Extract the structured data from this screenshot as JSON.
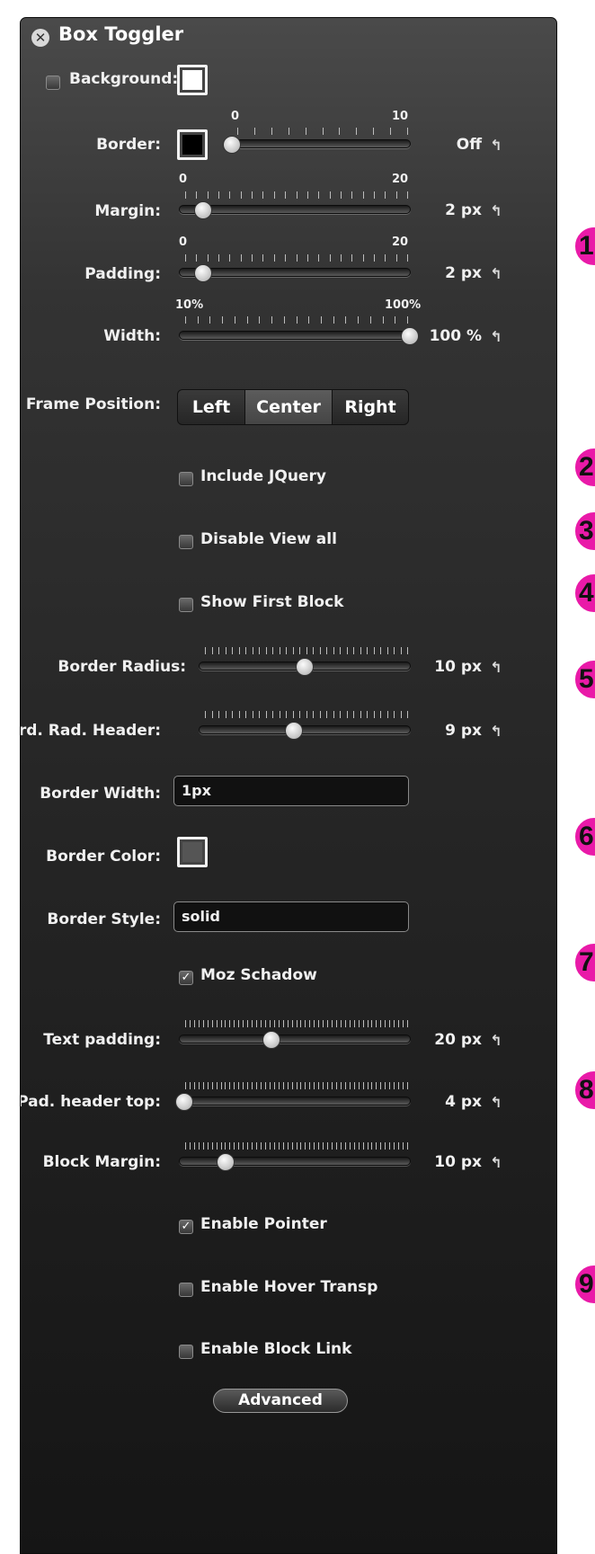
{
  "window": {
    "title": "Box Toggler"
  },
  "background": {
    "label": "Background:",
    "checked": false,
    "swatch_color": "#ffffff"
  },
  "border": {
    "label": "Border:",
    "swatch_color": "#000000",
    "min": "0",
    "max": "10",
    "value": 0,
    "value_text": "Off"
  },
  "margin": {
    "label": "Margin:",
    "min": "0",
    "max": "20",
    "value": 2,
    "value_text": "2 px"
  },
  "padding": {
    "label": "Padding:",
    "min": "0",
    "max": "20",
    "value": 2,
    "value_text": "2 px"
  },
  "width": {
    "label": "Width:",
    "min": "10%",
    "max": "100%",
    "value": 100,
    "value_text": "100 %"
  },
  "frame_position": {
    "label": "Frame Position:",
    "options": [
      "Left",
      "Center",
      "Right"
    ],
    "selected": "Center"
  },
  "include_jquery": {
    "label": "Include JQuery",
    "checked": false
  },
  "disable_view_all": {
    "label": "Disable View all",
    "checked": false
  },
  "show_first_block": {
    "label": "Show First Block",
    "checked": false
  },
  "border_radius": {
    "label": "Border Radius:",
    "value": 10,
    "max": 20,
    "value_text": "10 px"
  },
  "brd_rad_header": {
    "label": "Brd. Rad. Header:",
    "value": 9,
    "max": 20,
    "value_text": "9 px"
  },
  "border_width": {
    "label": "Border Width:",
    "value": "1px"
  },
  "border_color": {
    "label": "Border Color:",
    "swatch_color": "#555555"
  },
  "border_style": {
    "label": "Border Style:",
    "value": "solid"
  },
  "moz_schadow": {
    "label": "Moz Schadow",
    "checked": true
  },
  "text_padding": {
    "label": "Text padding:",
    "value": 20,
    "max": 50,
    "value_text": "20 px"
  },
  "pad_header_top": {
    "label": "Pad. header top:",
    "value": 4,
    "max": 200,
    "value_text": "4 px"
  },
  "block_margin": {
    "label": "Block Margin:",
    "value": 10,
    "max": 50,
    "value_text": "10 px"
  },
  "enable_pointer": {
    "label": "Enable Pointer",
    "checked": true
  },
  "enable_hover_transp": {
    "label": "Enable Hover Transp",
    "checked": false
  },
  "enable_block_link": {
    "label": "Enable Block Link",
    "checked": false
  },
  "advanced_button": {
    "label": "Advanced"
  },
  "callouts": [
    "1",
    "2",
    "3",
    "4",
    "5",
    "6",
    "7",
    "8",
    "9"
  ],
  "colors": {
    "callout": "#e91aa8",
    "panel_top": "#4a4a4a",
    "panel_bottom": "#151515"
  },
  "icons": {
    "close": "close-circle-icon",
    "reset": "reset-arrow-icon",
    "check": "checkmark-icon"
  }
}
